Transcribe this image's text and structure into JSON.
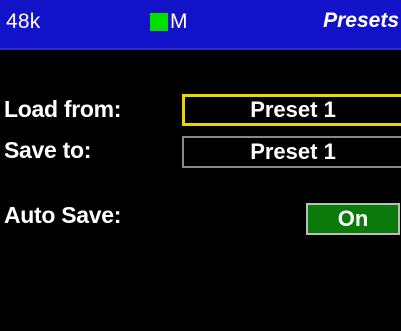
{
  "status_bar": {
    "sample_rate": "48k",
    "mode_label": "M",
    "mode_indicator_color": "#00e000",
    "screen_title": "Presets"
  },
  "presets": {
    "load_from": {
      "label": "Load from:",
      "value": "Preset 1"
    },
    "save_to": {
      "label": "Save to:",
      "value": "Preset 1"
    },
    "auto_save": {
      "label": "Auto Save:",
      "value": "On",
      "color": "#0a7a0a"
    }
  },
  "colors": {
    "status_bar_bg": "#1212c8",
    "focus_border": "#e8d800",
    "background": "#000000"
  }
}
